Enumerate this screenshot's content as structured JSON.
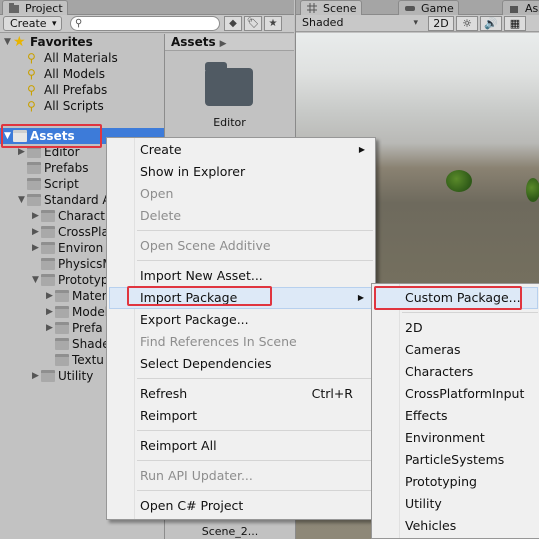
{
  "project": {
    "tab_label": "Project",
    "create_label": "Create",
    "favorites": {
      "label": "Favorites",
      "items": [
        "All Materials",
        "All Models",
        "All Prefabs",
        "All Scripts"
      ]
    },
    "assets": {
      "label": "Assets",
      "children": [
        "Editor",
        "Prefabs",
        "Script",
        "Standard A",
        "Charact",
        "CrossPla",
        "Environ",
        "PhysicsM",
        "Prototyp",
        "Mater",
        "Model",
        "Prefa",
        "Shade",
        "Textu",
        "Utility"
      ]
    },
    "breadcrumb": "Assets",
    "grid_folder_label": "Editor",
    "bottom_label": "Scene_2..."
  },
  "scene": {
    "tabs": [
      "Scene",
      "Game",
      "Ass"
    ],
    "shading": "Shaded",
    "mode_2d": "2D"
  },
  "context_menu": {
    "items": [
      {
        "label": "Create",
        "submenu": true
      },
      {
        "label": "Show in Explorer"
      },
      {
        "label": "Open",
        "disabled": true
      },
      {
        "label": "Delete",
        "disabled": true
      },
      {
        "label": "Open Scene Additive",
        "disabled": true
      },
      {
        "label": "Import New Asset..."
      },
      {
        "label": "Import Package",
        "submenu": true,
        "highlighted": true
      },
      {
        "label": "Export Package..."
      },
      {
        "label": "Find References In Scene",
        "disabled": true
      },
      {
        "label": "Select Dependencies"
      },
      {
        "label": "Refresh",
        "shortcut": "Ctrl+R"
      },
      {
        "label": "Reimport"
      },
      {
        "label": "Reimport All"
      },
      {
        "label": "Run API Updater...",
        "disabled": true
      },
      {
        "label": "Open C# Project"
      }
    ]
  },
  "import_package_menu": {
    "items": [
      "Custom Package...",
      "2D",
      "Cameras",
      "Characters",
      "CrossPlatformInput",
      "Effects",
      "Environment",
      "ParticleSystems",
      "Prototyping",
      "Utility",
      "Vehicles"
    ]
  },
  "colors": {
    "selection": "#3d7bd9",
    "highlight_box": "#e0353f",
    "menu_background": "#f0f0f0"
  }
}
